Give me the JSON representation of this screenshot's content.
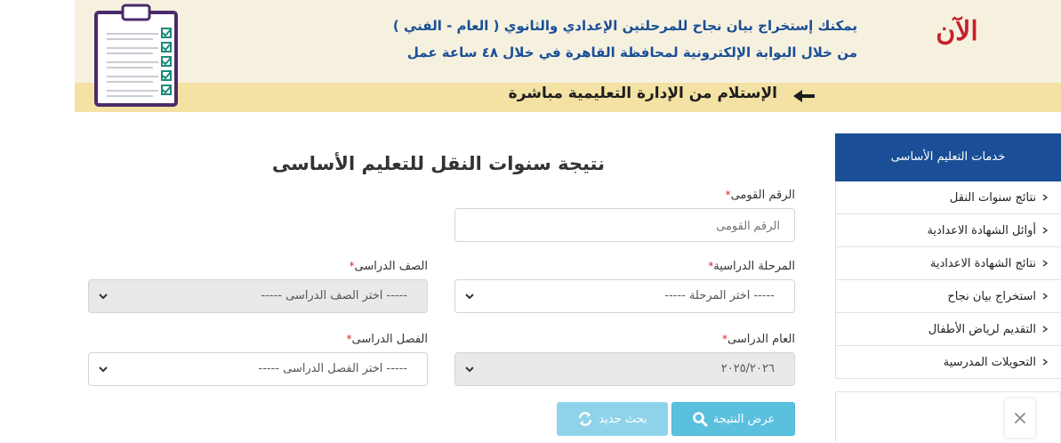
{
  "banner": {
    "now_label": "الآن",
    "line1": "يمكنك إستخراج بيان نجاح للمرحلتين الإعدادي والثانوي ( العام - الفني )",
    "line2": "من خلال البوابة الإلكترونية لمحافظة القاهرة في خلال ٤٨ ساعة عمل",
    "receive_line": "الإستلام من الإدارة التعليمية مباشرة",
    "icon": "clipboard-checklist-icon"
  },
  "form": {
    "title": "نتيجة سنوات النقل للتعليم الأساسى",
    "national_id": {
      "label": "الرقم القومى",
      "placeholder": "الرقم القومى",
      "value": ""
    },
    "stage": {
      "label": "المرحلة الدراسية",
      "selected": "----- اختر المرحلة -----"
    },
    "grade": {
      "label": "الصف الدراسى",
      "selected": "----- اختر الصف الدراسى -----"
    },
    "year": {
      "label": "العام الدراسى",
      "selected": "٢٠٢٥/٢٠٢٦"
    },
    "term": {
      "label": "الفصل الدراسى",
      "selected": "----- اختر الفصل الدراسى -----"
    },
    "required_mark": "*",
    "show_result_button": "عرض النتيجة",
    "new_search_button": "بحث جديد"
  },
  "sidebar": {
    "header": "خدمات التعليم الأساسى",
    "items": [
      {
        "label": "نتائج سنوات النقل"
      },
      {
        "label": "أوائل الشهادة الاعدادية"
      },
      {
        "label": "نتائج الشهادة الاعدادية"
      },
      {
        "label": "استخراج بيان نجاح"
      },
      {
        "label": "التقديم لرياض الأطفال"
      },
      {
        "label": "التحويلات المدرسية"
      }
    ]
  },
  "colors": {
    "primary": "#1a4f97",
    "button": "#5bc0de",
    "required": "#d9282f",
    "accent_red": "#c8202a"
  }
}
